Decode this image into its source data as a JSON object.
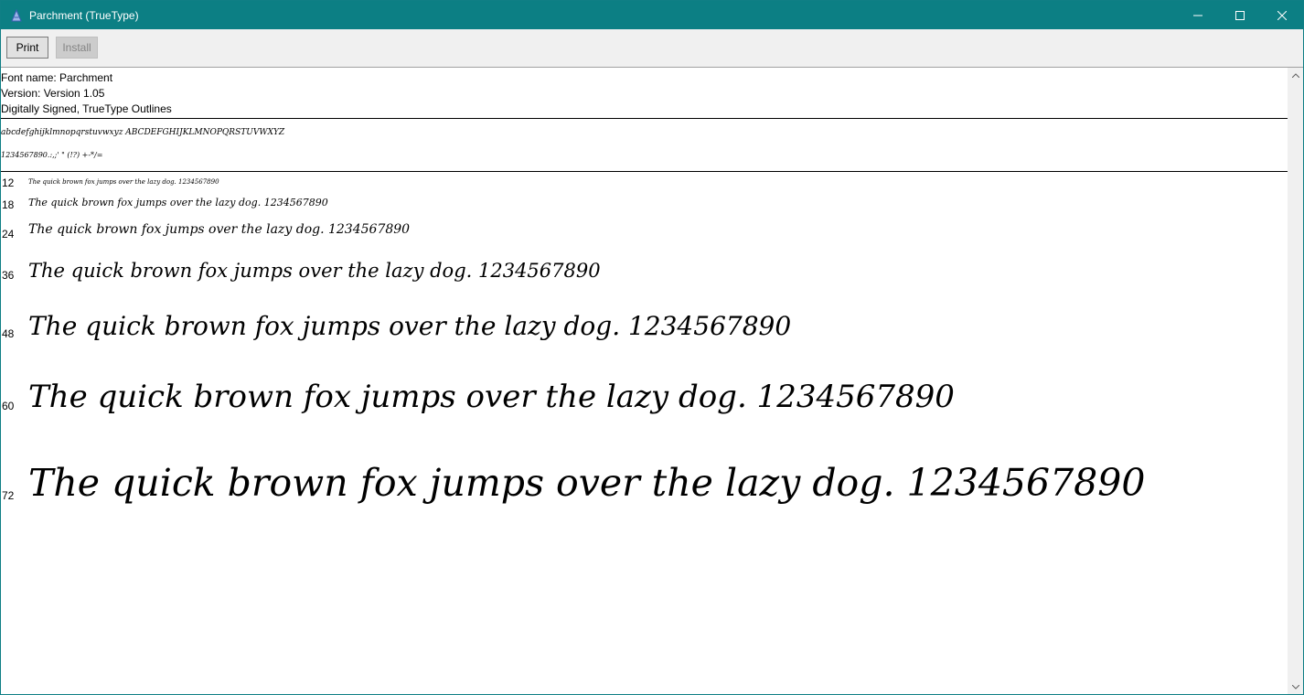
{
  "window": {
    "title": "Parchment (TrueType)"
  },
  "toolbar": {
    "print_label": "Print",
    "install_label": "Install"
  },
  "info": {
    "font_name": "Font name: Parchment",
    "version": "Version: Version 1.05",
    "signature": "Digitally Signed, TrueType Outlines"
  },
  "charset": {
    "line1": "abcdefghijklmnopqrstuvwxyz ABCDEFGHIJKLMNOPQRSTUVWXYZ",
    "line2": "1234567890.:,;' \" (!?) +-*/="
  },
  "samples": [
    {
      "size": "12",
      "text": "The quick brown fox jumps over the lazy dog. 1234567890"
    },
    {
      "size": "18",
      "text": "The quick brown fox jumps over the lazy dog. 1234567890"
    },
    {
      "size": "24",
      "text": "The quick brown fox jumps over the lazy dog. 1234567890"
    },
    {
      "size": "36",
      "text": "The quick brown fox jumps over the lazy dog. 1234567890"
    },
    {
      "size": "48",
      "text": "The quick brown fox jumps over the lazy dog. 1234567890"
    },
    {
      "size": "60",
      "text": "The quick brown fox jumps over the lazy dog. 1234567890"
    },
    {
      "size": "72",
      "text": "The quick brown fox jumps over the lazy dog. 1234567890"
    }
  ],
  "icons": {
    "app": "font-viewer-icon",
    "minimize": "minimize-icon",
    "maximize": "maximize-icon",
    "close": "close-icon",
    "scroll_up": "scroll-up-arrow-icon",
    "scroll_down": "scroll-down-arrow-icon"
  },
  "colors": {
    "titlebar": "#0c7f84",
    "title_text": "#ffffff",
    "toolbar_bg": "#f0f0f0",
    "disabled_text": "#838383"
  }
}
